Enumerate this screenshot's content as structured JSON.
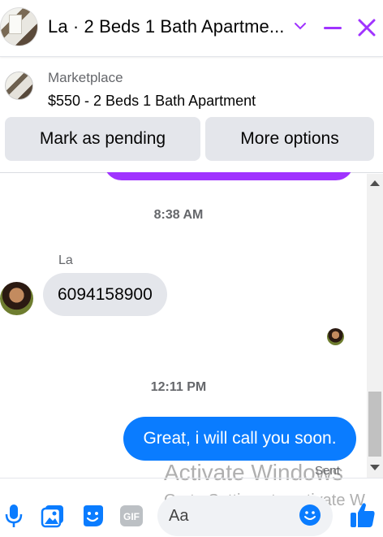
{
  "header": {
    "title": "La · 2 Beds 1 Bath Apartme...",
    "accent_color": "#a033ff"
  },
  "listing": {
    "source_label": "Marketplace",
    "title": "$550 - 2 Beds 1 Bath Apartment"
  },
  "actions": {
    "mark_pending_label": "Mark as pending",
    "more_options_label": "More options"
  },
  "messages": {
    "timestamp_1": "8:38 AM",
    "sender_name": "La",
    "incoming_text": "6094158900",
    "timestamp_2": "12:11 PM",
    "outgoing_text": "Great, i will call you soon.",
    "status": "Sent",
    "outgoing_color": "#0a7cff"
  },
  "watermark": {
    "line1": "Activate Windows",
    "line2": "Go to Settings to activate W"
  },
  "composer": {
    "placeholder": "Aa",
    "icons": [
      "microphone-icon",
      "photo-icon",
      "sticker-icon",
      "gif-icon",
      "emoji-icon",
      "like-icon"
    ]
  }
}
